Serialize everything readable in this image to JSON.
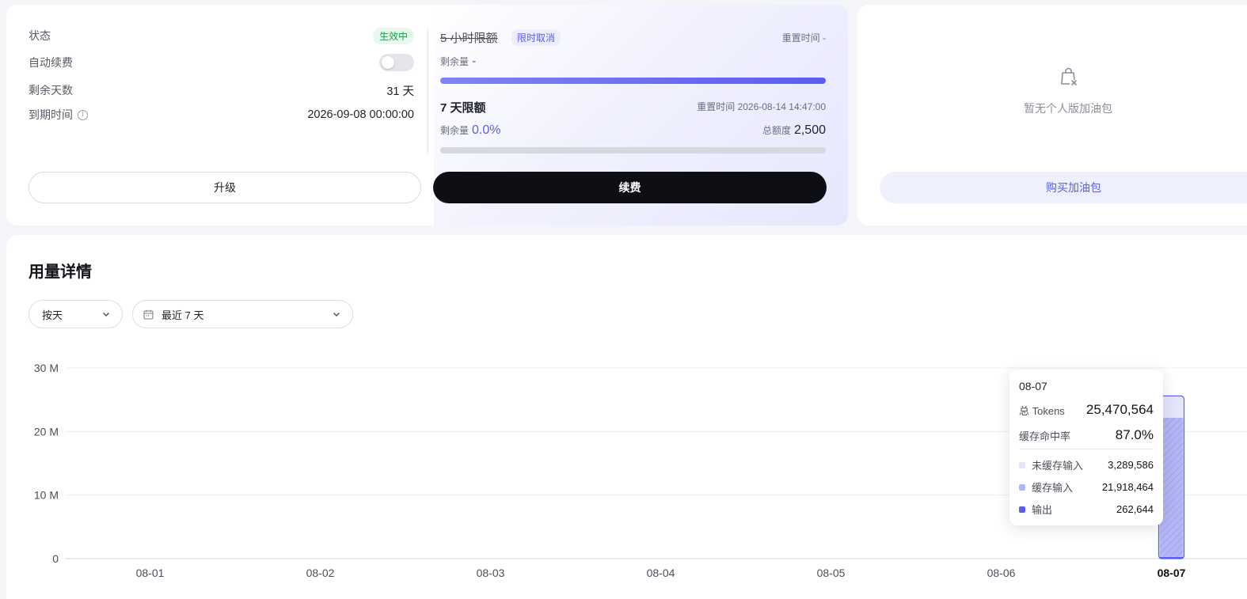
{
  "plan": {
    "status_label": "状态",
    "status_value": "生效中",
    "auto_renew_label": "自动续费",
    "auto_renew_on": false,
    "days_left_label": "剩余天数",
    "days_left_value": "31 天",
    "expire_label": "到期时间",
    "expire_value": "2026-09-08 00:00:00",
    "upgrade_label": "升级",
    "renew_label": "续费"
  },
  "quota": {
    "five_hour_title": "5 小时限额",
    "five_hour_tag": "限时取消",
    "five_hour_reset": "重置时间 -",
    "five_hour_remain_label": "剩余量",
    "five_hour_remain_value": "-",
    "five_hour_fill_fraction": 1.0,
    "seven_day_title": "7 天限额",
    "seven_day_reset": "重置时间 2026-08-14 14:47:00",
    "seven_day_remain_label": "剩余量",
    "seven_day_remain_value": "0.0%",
    "seven_day_total_label": "总额度",
    "seven_day_total_value": "2,500",
    "seven_day_fill_fraction": 0.0
  },
  "addon": {
    "empty_text": "暂无个人版加油包",
    "buy_label": "购买加油包"
  },
  "usage": {
    "title": "用量详情",
    "granularity": "按天",
    "range": "最近 7 天"
  },
  "colors": {
    "accent": "#5b5fe0",
    "uncached": "#e4e5fb",
    "cached": "#b4b7f5",
    "output": "#5a5ef0",
    "active_badge": "#1fa04a"
  },
  "chart_data": {
    "type": "bar",
    "stacked": true,
    "categories": [
      "08-01",
      "08-02",
      "08-03",
      "08-04",
      "08-05",
      "08-06",
      "08-07"
    ],
    "y_ticks": [
      "0",
      "10 M",
      "20 M",
      "30 M"
    ],
    "ylim": [
      0,
      30000000
    ],
    "grid": true,
    "highlighted_category": "08-07",
    "series": [
      {
        "name": "未缓存输入",
        "values": [
          0,
          0,
          0,
          0,
          0,
          0,
          3289586
        ]
      },
      {
        "name": "缓存输入",
        "values": [
          0,
          0,
          0,
          0,
          0,
          0,
          21918464
        ]
      },
      {
        "name": "输出",
        "values": [
          0,
          0,
          0,
          0,
          0,
          0,
          262644
        ]
      }
    ]
  },
  "tooltip": {
    "date": "08-07",
    "total_label": "总 Tokens",
    "total_value": "25,470,564",
    "hit_rate_label": "缓存命中率",
    "hit_rate_value": "87.0%",
    "uncached_label": "未缓存输入",
    "uncached_value": "3,289,586",
    "cached_label": "缓存输入",
    "cached_value": "21,918,464",
    "output_label": "输出",
    "output_value": "262,644"
  }
}
